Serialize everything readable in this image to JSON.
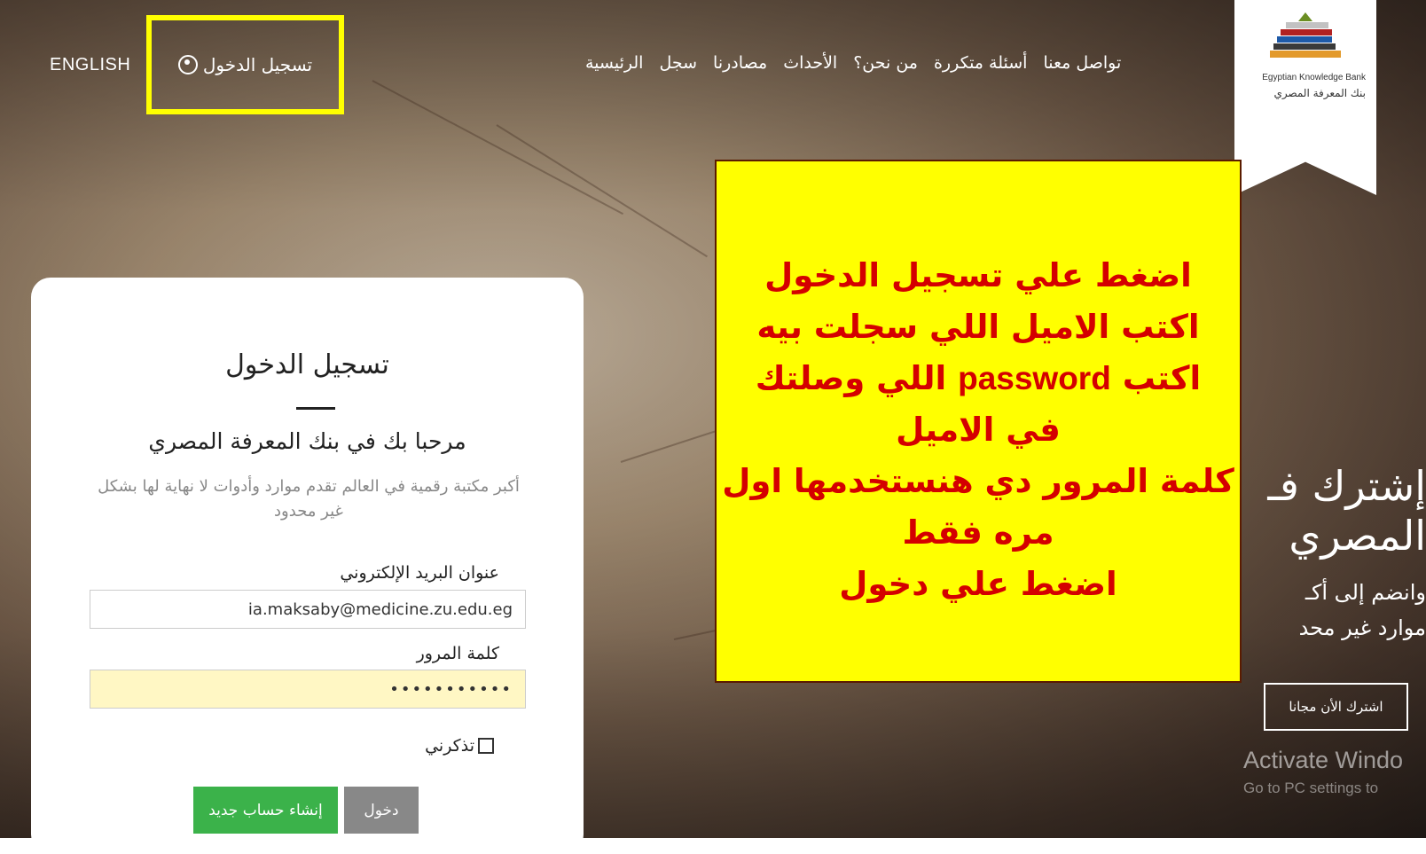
{
  "nav": {
    "english": "ENGLISH",
    "login": "تسجيل الدخول",
    "links": [
      "الرئيسية",
      "سجل",
      "مصادرنا",
      "الأحداث",
      "من نحن؟",
      "أسئلة متكررة",
      "تواصل معنا"
    ]
  },
  "logo": {
    "en": "Egyptian Knowledge Bank",
    "ar": "بنك المعرفة المصري"
  },
  "login_card": {
    "title": "تسجيل الدخول",
    "welcome": "مرحبا بك في بنك المعرفة المصري",
    "subtitle": "أكبر مكتبة رقمية في العالم تقدم موارد وأدوات لا نهاية لها بشكل غير محدود",
    "email_label": "عنوان البريد الإلكتروني",
    "email_value": "ia.maksaby@medicine.zu.edu.eg",
    "password_label": "كلمة المرور",
    "password_value": "•••••••••••",
    "remember": "تذكرني",
    "login_button": "دخول",
    "register_button": "إنشاء حساب جديد"
  },
  "callout": {
    "line1": "اضغط علي تسجيل الدخول",
    "line2": "اكتب الاميل اللي سجلت بيه",
    "line3_prefix": "اكتب",
    "line3_latin": "password",
    "line3_suffix": "اللي وصلتك",
    "line4": "في الاميل",
    "line5": "كلمة المرور دي هنستخدمها اول",
    "line6": "مره فقط",
    "line7": "اضغط علي دخول"
  },
  "hero": {
    "title_line1": "إشترك فـ",
    "title_line2": "المصري",
    "text_line1": "وانضم إلى أكـ",
    "text_line2": "موارد غير محد",
    "subscribe_button": "اشترك الأن مجانا"
  },
  "watermark": {
    "line1": "Activate Windo",
    "line2": "Go to PC settings to"
  },
  "colors": {
    "highlight": "#ffff00",
    "callout_text": "#d40000",
    "register_green": "#3bb24a",
    "login_gray": "#888888"
  }
}
